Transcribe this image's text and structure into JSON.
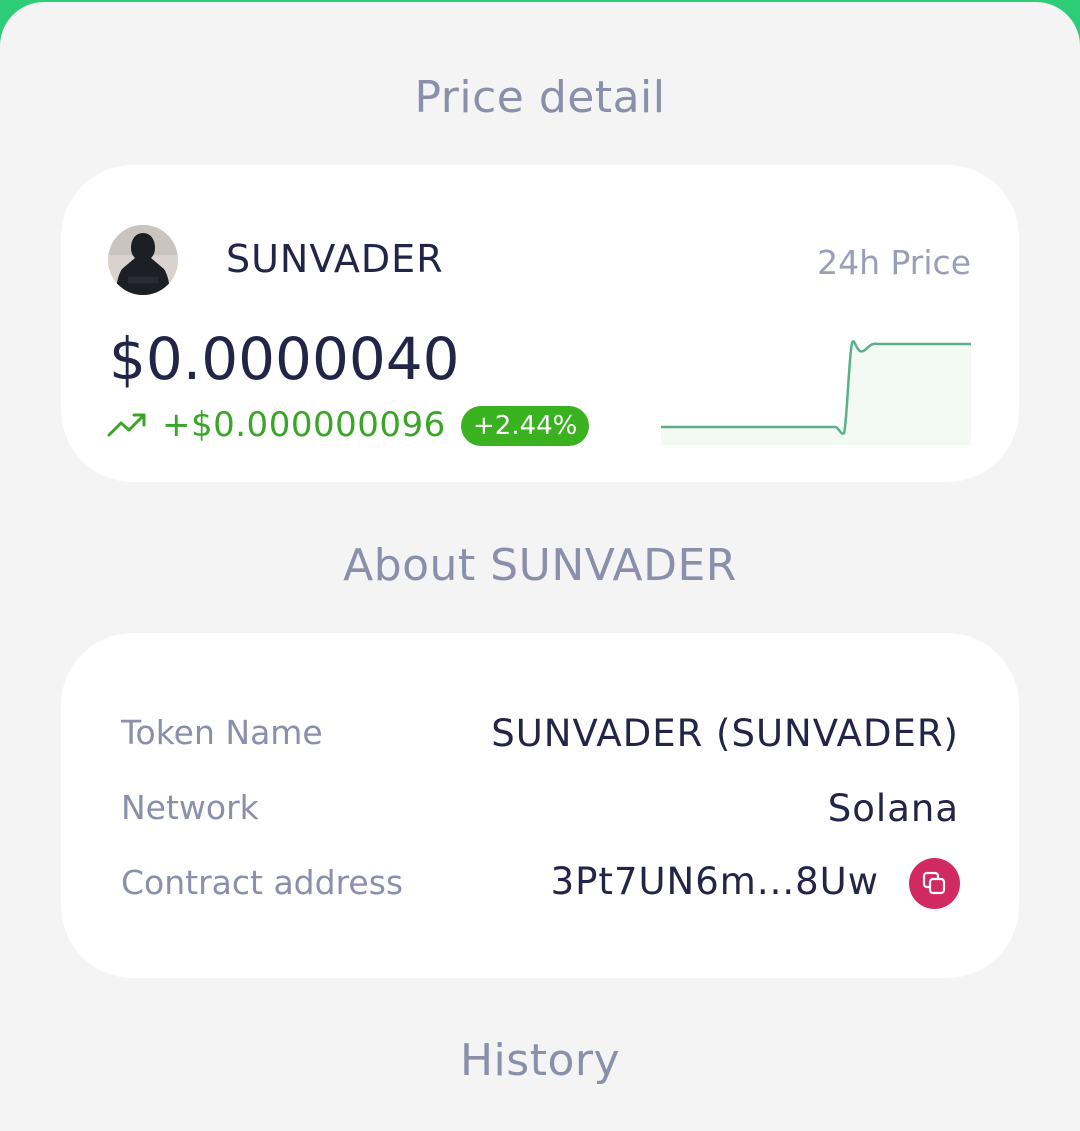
{
  "sections": {
    "price_detail_title": "Price detail",
    "about_title": "About SUNVADER",
    "history_title": "History"
  },
  "price_card": {
    "token_name": "SUNVADER",
    "period_label": "24h Price",
    "price": "$0.0000040",
    "change_absolute": "+$0.000000096",
    "change_percent": "+2.44%",
    "trend": "up",
    "trend_icon": "trending-up-icon",
    "colors": {
      "positive": "#3aa527",
      "badge": "#3ab21f",
      "sparkline_line": "#5bb08a",
      "sparkline_fill": "#f3faf3"
    }
  },
  "about_card": {
    "rows": [
      {
        "label": "Token Name",
        "value": "SUNVADER (SUNVADER)"
      },
      {
        "label": "Network",
        "value": "Solana"
      },
      {
        "label": "Contract address",
        "value": "3Pt7UN6m...8Uw"
      }
    ],
    "copy_icon": "copy-icon",
    "copy_color": "#d12a63"
  }
}
